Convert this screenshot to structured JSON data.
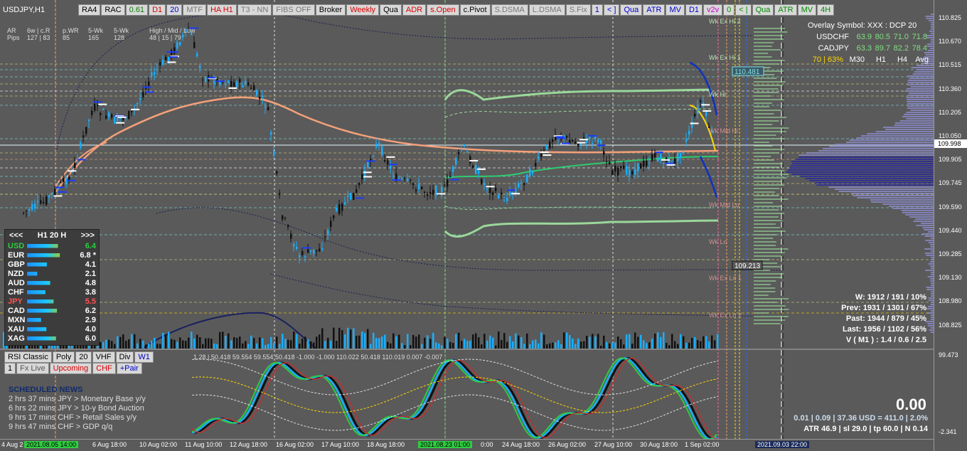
{
  "window": {
    "symbol": "USDJPY,H1"
  },
  "toolbar": [
    {
      "label": "RA4",
      "color": "#000"
    },
    {
      "label": "RAC",
      "color": "#000"
    },
    {
      "label": "0.61",
      "color": "#0a7a0a"
    },
    {
      "label": "D1",
      "color": "#d00"
    },
    {
      "label": "20",
      "color": "#00c"
    },
    {
      "label": "MTF",
      "color": "#777"
    },
    {
      "label": "HA H1",
      "color": "#d00"
    },
    {
      "label": "T3 - NN",
      "color": "#777"
    },
    {
      "label": "FIBS OFF",
      "color": "#777"
    },
    {
      "label": "Broker",
      "color": "#000"
    },
    {
      "label": "Weekly",
      "color": "#d00"
    },
    {
      "label": "Qua",
      "color": "#000"
    },
    {
      "label": "ADR",
      "color": "#d00"
    },
    {
      "label": "s.Open",
      "color": "#d00"
    },
    {
      "label": "c.Pivot",
      "color": "#000"
    },
    {
      "label": "S.DSMA",
      "color": "#777"
    },
    {
      "label": "L.DSMA",
      "color": "#777"
    },
    {
      "label": "S.Fix",
      "color": "#777"
    },
    {
      "label": "1",
      "color": "#00c"
    },
    {
      "label": "< ]",
      "color": "#00c"
    },
    {
      "label": "Qua",
      "color": "#00c"
    },
    {
      "label": "ATR",
      "color": "#00c"
    },
    {
      "label": "MV",
      "color": "#00c"
    },
    {
      "label": "D1",
      "color": "#00c"
    },
    {
      "label": "v2v",
      "color": "#c0c"
    },
    {
      "label": "0",
      "color": "#080"
    },
    {
      "label": "< |",
      "color": "#080"
    },
    {
      "label": "Qua",
      "color": "#080"
    },
    {
      "label": "ATR",
      "color": "#080"
    },
    {
      "label": "MV",
      "color": "#080"
    },
    {
      "label": "4H",
      "color": "#080"
    }
  ],
  "stats_header": {
    "row1": [
      "AR",
      "6w | c.R",
      "p.WR",
      "5-Wk",
      "5-Wk",
      "High / Mid / Low"
    ],
    "row2": [
      "Pips",
      "127 | 83",
      "85",
      "165",
      "128",
      "48 | 15 | 79"
    ]
  },
  "strength": {
    "header": {
      "left": "<<<",
      "tf": "H1",
      "n": "20",
      "unit": "H",
      "right": ">>>"
    },
    "rows": [
      {
        "cur": "USD",
        "val": "6.4",
        "color": "#2ecc40",
        "bar": 0.64
      },
      {
        "cur": "EUR",
        "val": "6.8 *",
        "color": "#ffffff",
        "bar": 0.68
      },
      {
        "cur": "GBP",
        "val": "4.1",
        "color": "#ffffff",
        "bar": 0.41
      },
      {
        "cur": "NZD",
        "val": "2.1",
        "color": "#ffffff",
        "bar": 0.21
      },
      {
        "cur": "AUD",
        "val": "4.8",
        "color": "#ffffff",
        "bar": 0.48
      },
      {
        "cur": "CHF",
        "val": "3.8",
        "color": "#ffffff",
        "bar": 0.38
      },
      {
        "cur": "JPY",
        "val": "5.5",
        "color": "#ff5555",
        "bar": 0.55
      },
      {
        "cur": "CAD",
        "val": "6.2",
        "color": "#ffffff",
        "bar": 0.62
      },
      {
        "cur": "MXN",
        "val": "2.9",
        "color": "#ffffff",
        "bar": 0.29
      },
      {
        "cur": "XAU",
        "val": "4.0",
        "color": "#ffffff",
        "bar": 0.4
      },
      {
        "cur": "XAG",
        "val": "6.0",
        "color": "#ffffff",
        "bar": 0.6
      }
    ]
  },
  "overlay": {
    "title": "Overlay Symbol: XXX : DCP 20",
    "rows": [
      {
        "sym": "USDCHF",
        "v": [
          "63.9",
          "80.5",
          "71.0",
          "71.8"
        ]
      },
      {
        "sym": "CADJPY",
        "v": [
          "63.3",
          "89.7",
          "82.2",
          "78.4"
        ]
      }
    ],
    "footer": {
      "left": "70 | 63%",
      "cols": [
        "M30",
        "H1",
        "H4",
        "Avg"
      ]
    }
  },
  "weekly_levels": [
    "Wk Ex Hi 2",
    "Wk Ex Hi 1",
    "Wk Hi",
    "Wk Mid Hi",
    "Wk Mid Lo",
    "Wk Lo",
    "Wk Ex Lo 1",
    "Wk Ex Lo 2"
  ],
  "price_tags": {
    "upper": "110.481",
    "lower": "109.213"
  },
  "right_stats": [
    "W: 1912 / 191 / 10%",
    "Prev: 1931 / 1301 / 67%",
    "Past: 1944 / 879 / 45%",
    "Last: 1956 / 1102 / 56%",
    "V ( M1 ) : 1.4 / 0.6 / 2.5"
  ],
  "price_axis": {
    "labels": [
      "110.825",
      "110.670",
      "110.515",
      "110.360",
      "110.205",
      "110.050",
      "109.905",
      "109.745",
      "109.590",
      "109.440",
      "109.285",
      "109.130",
      "108.980",
      "108.825"
    ],
    "current": "109.998",
    "sub_top": "99.473",
    "sub_bottom": "-2.341"
  },
  "time_axis": [
    "4 Aug 2",
    "2021.08.05 14:00",
    "6 Aug 18:00",
    "10 Aug 02:00",
    "11 Aug 10:00",
    "12 Aug 18:00",
    "16 Aug 02:00",
    "17 Aug 10:00",
    "18 Aug 18:00",
    "2021.08.23 01:00",
    "0:00",
    "24 Aug 18:00",
    "26 Aug 02:00",
    "27 Aug 10:00",
    "30 Aug 18:00",
    "1 Sep 02:00",
    "2021.09.03 22:00"
  ],
  "sub_toolbar": [
    {
      "label": "RSI Classic",
      "color": "#000"
    },
    {
      "label": "Poly",
      "color": "#000"
    },
    {
      "label": "20",
      "color": "#000"
    },
    {
      "label": "VHF",
      "color": "#000"
    },
    {
      "label": "Div",
      "color": "#000"
    },
    {
      "label": "W1",
      "color": "#00c"
    }
  ],
  "sub_toolbar2": [
    {
      "label": "1",
      "color": "#000"
    },
    {
      "label": "Fx Live",
      "color": "#555"
    },
    {
      "label": "Upcoming",
      "color": "#d00"
    },
    {
      "label": "CHF",
      "color": "#d00"
    },
    {
      "label": "+Pair",
      "color": "#00c"
    }
  ],
  "sub_values": "1.28 | 50.418 59.554 59.554 50.418 -1.000 -1.000 110.022 50.418 110.019 0.007 -0.007",
  "news": {
    "title": "SCHEDULED NEWS",
    "items": [
      "2 hrs 37 mins  JPY  >  Monetary Base y/y",
      "6 hrs 22 mins  JPY  >  10-y Bond Auction",
      "9 hrs 17 mins  CHF  >  Retail Sales y/y",
      "9 hrs 47 mins  CHF  >  GDP q/q"
    ]
  },
  "bottom": {
    "big": "0.00",
    "line1": "0.01  |  0.09  |  37.36 USD = 411.0  |  2.0%",
    "line2": "ATR 46.9  |  sl 29.0  |  tp 60.0  |  N 0.14"
  }
}
